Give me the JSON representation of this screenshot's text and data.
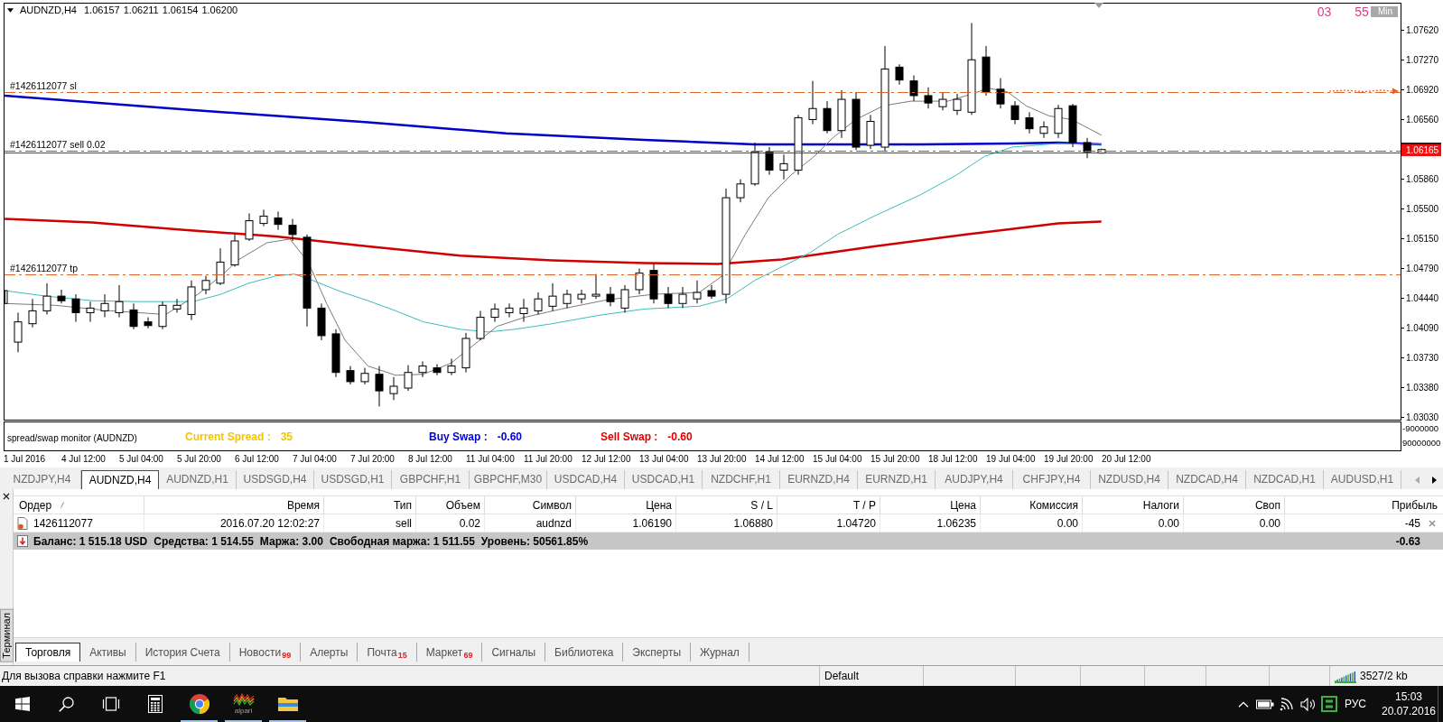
{
  "chart": {
    "symbol": "AUDNZD,H4",
    "prices": [
      "1.06157",
      "1.06211",
      "1.06154",
      "1.06200"
    ],
    "timer": {
      "values": [
        "03",
        "55"
      ],
      "unit": "Min"
    },
    "order_lines": [
      {
        "kind": "sl",
        "label": "#1426112077 sl"
      },
      {
        "kind": "order",
        "label": "#1426112077 sell 0.02"
      },
      {
        "kind": "tp",
        "label": "#1426112077 tp"
      }
    ],
    "price_axis": [
      {
        "kind": "tick",
        "text": "1.07620"
      },
      {
        "kind": "tick",
        "text": "1.07270"
      },
      {
        "kind": "tick",
        "text": "1.06920"
      },
      {
        "kind": "tick",
        "text": "1.06560"
      },
      {
        "kind": "current",
        "text": "1.06165"
      },
      {
        "kind": "tick",
        "text": "1.05860"
      },
      {
        "kind": "tick",
        "text": "1.05500"
      },
      {
        "kind": "tick",
        "text": "1.05150"
      },
      {
        "kind": "tick",
        "text": "1.04790"
      },
      {
        "kind": "tick",
        "text": "1.04440"
      },
      {
        "kind": "tick",
        "text": "1.04090"
      },
      {
        "kind": "tick",
        "text": "1.03730"
      },
      {
        "kind": "tick",
        "text": "1.03380"
      },
      {
        "kind": "tick",
        "text": "1.03030"
      }
    ],
    "indicator": {
      "title": "spread/swap monitor (AUDNZD)",
      "readouts": [
        {
          "label": "Current Spread :",
          "value": "35",
          "color": "#f5c400"
        },
        {
          "label": "Buy Swap :",
          "value": "-0.60",
          "color": "#0000d0"
        },
        {
          "label": "Sell Swap :",
          "value": "-0.60",
          "color": "#e00000"
        }
      ],
      "axis": [
        "-9000000",
        "90000000"
      ]
    },
    "time_axis": [
      "1 Jul 2016",
      "4 Jul 12:00",
      "5 Jul 04:00",
      "5 Jul 20:00",
      "6 Jul 12:00",
      "7 Jul 04:00",
      "7 Jul 20:00",
      "8 Jul 12:00",
      "11 Jul 04:00",
      "11 Jul 20:00",
      "12 Jul 12:00",
      "13 Jul 04:00",
      "13 Jul 20:00",
      "14 Jul 12:00",
      "15 Jul 04:00",
      "15 Jul 20:00",
      "18 Jul 12:00",
      "19 Jul 04:00",
      "19 Jul 20:00",
      "20 Jul 12:00"
    ]
  },
  "symbol_tabs": [
    {
      "label": "NZDJPY,H4",
      "selected": false
    },
    {
      "label": "AUDNZD,H4",
      "selected": true
    },
    {
      "label": "AUDNZD,H1",
      "selected": false
    },
    {
      "label": "USDSGD,H4",
      "selected": false
    },
    {
      "label": "USDSGD,H1",
      "selected": false
    },
    {
      "label": "GBPCHF,H1",
      "selected": false
    },
    {
      "label": "GBPCHF,M30",
      "selected": false
    },
    {
      "label": "USDCAD,H4",
      "selected": false
    },
    {
      "label": "USDCAD,H1",
      "selected": false
    },
    {
      "label": "NZDCHF,H1",
      "selected": false
    },
    {
      "label": "EURNZD,H4",
      "selected": false
    },
    {
      "label": "EURNZD,H1",
      "selected": false
    },
    {
      "label": "AUDJPY,H4",
      "selected": false
    },
    {
      "label": "CHFJPY,H4",
      "selected": false
    },
    {
      "label": "NZDUSD,H4",
      "selected": false
    },
    {
      "label": "NZDCAD,H4",
      "selected": false
    },
    {
      "label": "NZDCAD,H1",
      "selected": false
    },
    {
      "label": "AUDUSD,H1",
      "selected": false
    }
  ],
  "tab_scroll": [
    {
      "kind": "left",
      "disabled": true
    },
    {
      "kind": "right",
      "disabled": false
    }
  ],
  "terminal": {
    "title": "Терминал",
    "columns": [
      "Ордер",
      "Время",
      "Тип",
      "Объем",
      "Символ",
      "Цена",
      "S / L",
      "T / P",
      "Цена",
      "Комиссия",
      "Налоги",
      "Своп",
      "Прибыль"
    ],
    "rows": [
      {
        "cells": [
          "1426112077",
          "2016.07.20 12:02:27",
          "sell",
          "0.02",
          "audnzd",
          "1.06190",
          "1.06880",
          "1.04720",
          "1.06235",
          "0.00",
          "0.00",
          "0.00",
          "-45"
        ]
      }
    ],
    "summary": {
      "items": [
        "Баланс: 1 515.18 USD",
        "Средства: 1 514.55",
        "Маржа: 3.00",
        "Свободная маржа: 1 511.55",
        "Уровень: 50561.85%"
      ],
      "total": "-0.63"
    },
    "tabs": [
      {
        "label": "Торговля",
        "selected": true
      },
      {
        "label": "Активы",
        "selected": false
      },
      {
        "label": "История Счета",
        "selected": false
      },
      {
        "label": "Новости",
        "badge": "99",
        "selected": false
      },
      {
        "label": "Алерты",
        "selected": false
      },
      {
        "label": "Почта",
        "badge": "15",
        "selected": false
      },
      {
        "label": "Маркет",
        "badge": "69",
        "selected": false
      },
      {
        "label": "Сигналы",
        "selected": false
      },
      {
        "label": "Библиотека",
        "selected": false
      },
      {
        "label": "Эксперты",
        "selected": false
      },
      {
        "label": "Журнал",
        "selected": false
      }
    ]
  },
  "status_bar": {
    "help": "Для вызова справки нажмите F1",
    "profile": "Default",
    "traffic": "3527/2 kb"
  },
  "taskbar": {
    "apps": [
      {
        "kind": "start",
        "running": false
      },
      {
        "kind": "search",
        "running": false
      },
      {
        "kind": "task_view",
        "running": false
      },
      {
        "kind": "calculator",
        "running": false
      },
      {
        "kind": "browser",
        "running": true
      },
      {
        "kind": "trading",
        "label": "alpari",
        "running": true
      },
      {
        "kind": "folder",
        "running": true
      }
    ],
    "language": "РУС",
    "time": "15:03",
    "date": "20.07.2016"
  }
}
